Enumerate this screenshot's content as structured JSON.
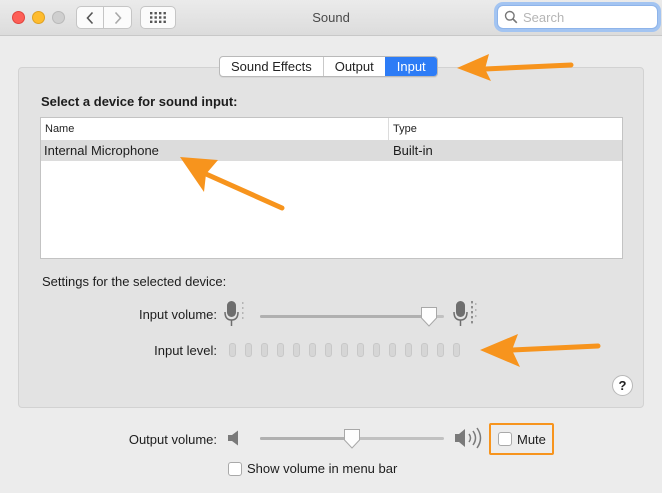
{
  "window": {
    "title": "Sound",
    "search_placeholder": "Search"
  },
  "tabs": [
    {
      "label": "Sound Effects",
      "active": false
    },
    {
      "label": "Output",
      "active": false
    },
    {
      "label": "Input",
      "active": true
    }
  ],
  "input": {
    "section_title": "Select a device for sound input:",
    "columns": [
      "Name",
      "Type"
    ],
    "devices": [
      {
        "name": "Internal Microphone",
        "type": "Built-in",
        "selected": true
      }
    ],
    "settings_title": "Settings for the selected device:",
    "input_volume_label": "Input volume:",
    "input_volume_level": 0.92,
    "input_level_label": "Input level:",
    "input_level_segments": 15,
    "input_level_active": 0
  },
  "help_label": "?",
  "output": {
    "volume_label": "Output volume:",
    "volume_level": 0.5,
    "mute_label": "Mute",
    "mute_checked": false,
    "show_menu_bar_label": "Show volume in menu bar",
    "show_menu_bar_checked": false
  },
  "colors": {
    "accent": "#2d7cf6",
    "annotation": "#f7941d"
  },
  "icons": [
    "back-chevron-icon",
    "forward-chevron-icon",
    "grid-icon",
    "search-icon",
    "microphone-icon",
    "speaker-icon",
    "help-icon",
    "annotation-arrow"
  ]
}
